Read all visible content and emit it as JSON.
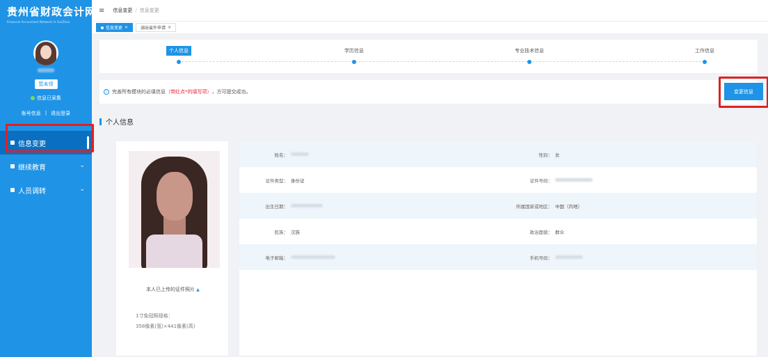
{
  "sidebar": {
    "logo_title": "贵州省财政会计网",
    "logo_subtitle": "Financial Accountant Network in GuiZhou",
    "account_badge": "暂未领",
    "status_text": "信息已采集",
    "account_info_link": "账号信息",
    "link_separator": "|",
    "logout_link": "退出登录",
    "nav": [
      {
        "label": "信息变更"
      },
      {
        "label": "继续教育"
      },
      {
        "label": "人员调转"
      }
    ],
    "chevron": "⌄"
  },
  "topbar": {
    "menu_icon": "≡",
    "breadcrumb_home": "信息变更",
    "breadcrumb_sep": "/",
    "breadcrumb_current": "信息变更"
  },
  "tabs": [
    {
      "label": "信息变更",
      "close": "×"
    },
    {
      "label": "调出省外申请",
      "close": "×"
    }
  ],
  "steps": [
    {
      "label": "个人信息"
    },
    {
      "label": "学历信息"
    },
    {
      "label": "专业技术信息"
    },
    {
      "label": "工作信息"
    }
  ],
  "notice": {
    "icon": "i",
    "prefix": "完善所有模块的必填信息",
    "highlight": "（带红点*的填写项）",
    "suffix": "，方可提交成功。",
    "button": "变更信息"
  },
  "section_title": "个人信息",
  "photo": {
    "caption": "本人已上传的证件照片",
    "caret": "▲",
    "spec_label": "1寸免冠照规格：",
    "spec_value": "358像素(宽)×441像素(高)"
  },
  "details": {
    "name_label": "姓名：",
    "gender_label": "性别：",
    "gender_value": "女",
    "id_type_label": "证件类型：",
    "id_type_value": "身份证",
    "id_number_label": "证件号码：",
    "birth_label": "出生日期：",
    "region_label": "所属国家或地区：",
    "region_value": "中国（内地）",
    "ethnicity_label": "民族：",
    "ethnicity_value": "汉族",
    "politics_label": "政治面貌：",
    "politics_value": "群众",
    "email_label": "电子邮箱：",
    "phone_label": "手机号码："
  },
  "colors": {
    "primary": "#1f93e6",
    "highlight_box": "#e02020",
    "required_text": "#f5222d"
  }
}
